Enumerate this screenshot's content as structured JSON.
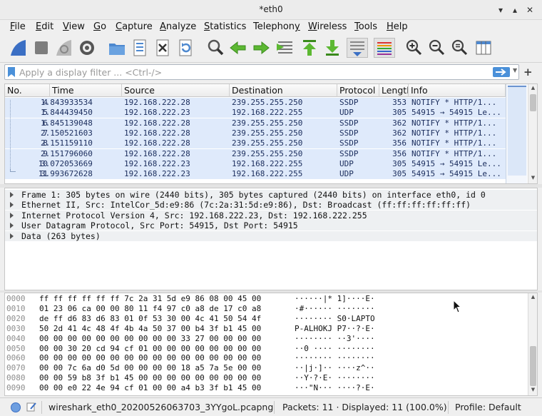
{
  "window": {
    "title": "*eth0"
  },
  "menu": [
    "File",
    "Edit",
    "View",
    "Go",
    "Capture",
    "Analyze",
    "Statistics",
    "Telephony",
    "Wireless",
    "Tools",
    "Help"
  ],
  "menu_mnemonic": [
    "F",
    "E",
    "V",
    "G",
    "C",
    "A",
    "S",
    "y",
    "W",
    "T",
    "H"
  ],
  "filter": {
    "placeholder": "Apply a display filter ... <Ctrl-/>"
  },
  "columns": [
    "No.",
    "Time",
    "Source",
    "Destination",
    "Protocol",
    "Length",
    "Info"
  ],
  "packets": [
    {
      "no": "4",
      "time": "1.843933534",
      "src": "192.168.222.28",
      "dst": "239.255.255.250",
      "proto": "SSDP",
      "len": "353",
      "info": "NOTIFY * HTTP/1..."
    },
    {
      "no": "5",
      "time": "1.844439450",
      "src": "192.168.222.23",
      "dst": "192.168.222.255",
      "proto": "UDP",
      "len": "305",
      "info": "54915 → 54915 Le..."
    },
    {
      "no": "6",
      "time": "1.845139048",
      "src": "192.168.222.28",
      "dst": "239.255.255.250",
      "proto": "SSDP",
      "len": "362",
      "info": "NOTIFY * HTTP/1..."
    },
    {
      "no": "7",
      "time": "2.150521603",
      "src": "192.168.222.28",
      "dst": "239.255.255.250",
      "proto": "SSDP",
      "len": "362",
      "info": "NOTIFY * HTTP/1..."
    },
    {
      "no": "8",
      "time": "2.151159110",
      "src": "192.168.222.28",
      "dst": "239.255.255.250",
      "proto": "SSDP",
      "len": "356",
      "info": "NOTIFY * HTTP/1..."
    },
    {
      "no": "9",
      "time": "2.151796060",
      "src": "192.168.222.28",
      "dst": "239.255.255.250",
      "proto": "SSDP",
      "len": "356",
      "info": "NOTIFY * HTTP/1..."
    },
    {
      "no": "10",
      "time": "3.072053669",
      "src": "192.168.222.23",
      "dst": "192.168.222.255",
      "proto": "UDP",
      "len": "305",
      "info": "54915 → 54915 Le..."
    },
    {
      "no": "11",
      "time": "3.993672628",
      "src": "192.168.222.23",
      "dst": "192.168.222.255",
      "proto": "UDP",
      "len": "305",
      "info": "54915 → 54915 Le..."
    }
  ],
  "details": [
    "Frame 1: 305 bytes on wire (2440 bits), 305 bytes captured (2440 bits) on interface eth0, id 0",
    "Ethernet II, Src: IntelCor_5d:e9:86 (7c:2a:31:5d:e9:86), Dst: Broadcast (ff:ff:ff:ff:ff:ff)",
    "Internet Protocol Version 4, Src: 192.168.222.23, Dst: 192.168.222.255",
    "User Datagram Protocol, Src Port: 54915, Dst Port: 54915",
    "Data (263 bytes)"
  ],
  "bytes": [
    {
      "off": "0000",
      "hex": "ff ff ff ff ff ff 7c 2a  31 5d e9 86 08 00 45 00",
      "asc": "······|* 1]····E·"
    },
    {
      "off": "0010",
      "hex": "01 23 06 ca 00 00 80 11  f4 97 c0 a8 de 17 c0 a8",
      "asc": "·#······ ········"
    },
    {
      "off": "0020",
      "hex": "de ff d6 83 d6 83 01 0f  53 30 00 4c 41 50 54 4f",
      "asc": "········ S0·LAPTO"
    },
    {
      "off": "0030",
      "hex": "50 2d 41 4c 48 4f 4b 4a  50 37 00 b4 3f b1 45 00",
      "asc": "P-ALHOKJ P7··?·E·"
    },
    {
      "off": "0040",
      "hex": "00 00 00 00 00 00 00 00  00 00 33 27 00 00 00 00",
      "asc": "········ ··3'····"
    },
    {
      "off": "0050",
      "hex": "00 00 30 20 cd 94 cf 01  00 00 00 00 00 00 00 00",
      "asc": "··0 ···· ········"
    },
    {
      "off": "0060",
      "hex": "00 00 00 00 00 00 00 00  00 00 00 00 00 00 00 00",
      "asc": "········ ········"
    },
    {
      "off": "0070",
      "hex": "00 00 7c 6a d0 5d 00 00  00 00 18 a5 7a 5e 00 00",
      "asc": "··|j·]·· ····z^··"
    },
    {
      "off": "0080",
      "hex": "00 00 59 b8 3f b1 45 00  00 00 00 00 00 00 00 00",
      "asc": "··Y·?·E· ········"
    },
    {
      "off": "0090",
      "hex": "00 00 e0 22 4e 94 cf 01  00 00 a4 b3 3f b1 45 00",
      "asc": "···\"N··· ····?·E·"
    }
  ],
  "status": {
    "file": "wireshark_eth0_20200526063703_3YYgoL.pcapng",
    "packets": "Packets: 11 · Displayed: 11 (100.0%)",
    "profile": "Profile: Default"
  },
  "colors": {
    "selected_row": "#dfeafb",
    "accent": "#4a90d9"
  }
}
